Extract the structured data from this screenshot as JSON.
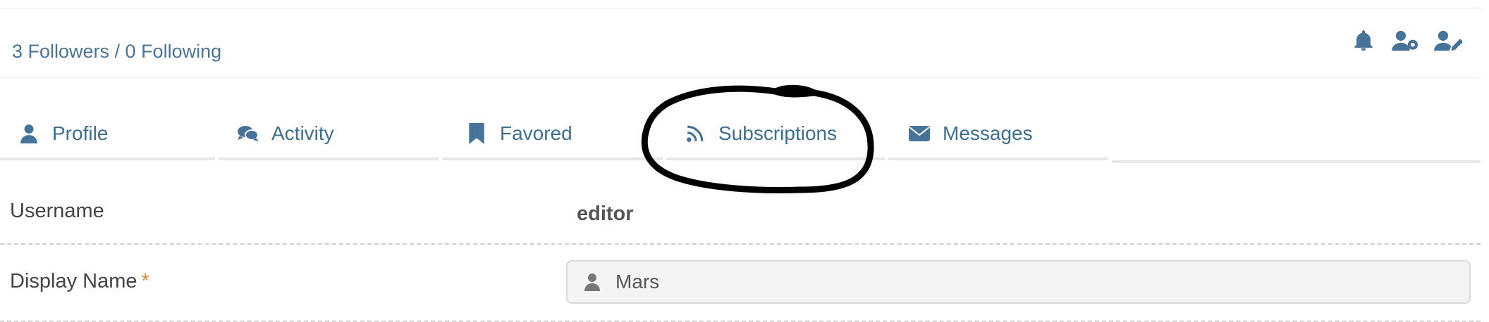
{
  "follow": {
    "text": "3 Followers / 0 Following"
  },
  "top_icons": [
    "bell-icon",
    "user-gear-icon",
    "user-edit-icon"
  ],
  "tabs": [
    {
      "label": "Profile",
      "icon": "user-icon"
    },
    {
      "label": "Activity",
      "icon": "comments-icon"
    },
    {
      "label": "Favored",
      "icon": "bookmark-icon"
    },
    {
      "label": "Subscriptions",
      "icon": "rss-icon",
      "annotated": true
    },
    {
      "label": "Messages",
      "icon": "envelope-icon"
    }
  ],
  "fields": {
    "username": {
      "label": "Username",
      "value": "editor"
    },
    "display_name": {
      "label": "Display Name",
      "required_mark": "*",
      "value": "Mars",
      "icon": "user-icon"
    }
  },
  "colors": {
    "link": "#4a7695",
    "tab_text": "#3c6f90",
    "required": "#e0893d",
    "annotation": "#000000"
  }
}
